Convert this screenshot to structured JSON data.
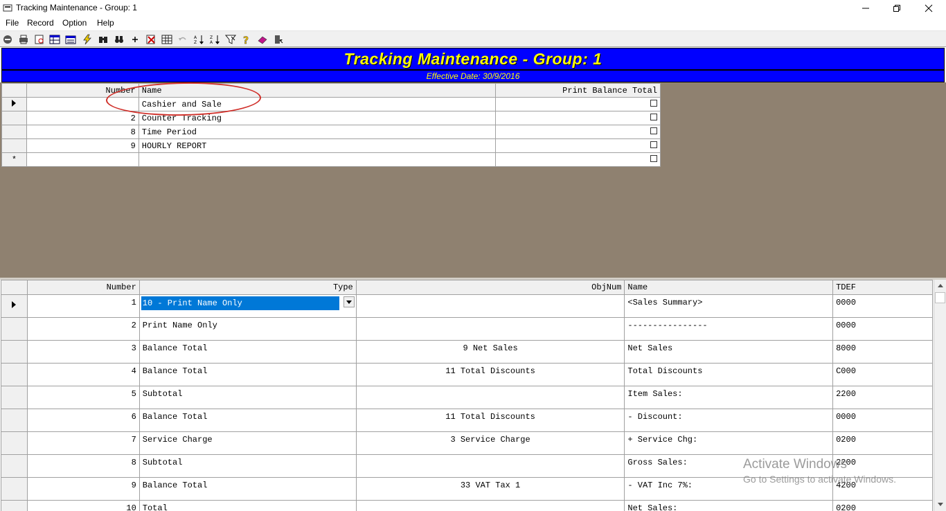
{
  "window": {
    "title": "Tracking Maintenance - Group: 1"
  },
  "menu": [
    "File",
    "Record",
    "Option",
    "Help"
  ],
  "toolbar_icons": [
    "exit-icon",
    "print-icon",
    "print-preview-icon",
    "table-view-icon",
    "form-view-icon",
    "lightning-icon",
    "find-icon",
    "binoculars-icon",
    "add-icon",
    "delete-icon",
    "grid-icon",
    "undo-icon",
    "sort-ascending-icon",
    "sort-descending-icon",
    "filter-icon",
    "help-icon",
    "eraser-icon",
    "door-exit-icon"
  ],
  "banner": {
    "title": "Tracking Maintenance - Group: 1",
    "effective_date": "Effective Date: 30/9/2016"
  },
  "groups_grid": {
    "columns": [
      "Number",
      "Name",
      "Print Balance Total"
    ],
    "rows": [
      {
        "number": "",
        "name": "Cashier and Sale",
        "print_balance_total": false
      },
      {
        "number": "2",
        "name": "Counter Tracking",
        "print_balance_total": false
      },
      {
        "number": "8",
        "name": "Time Period",
        "print_balance_total": false
      },
      {
        "number": "9",
        "name": "HOURLY REPORT",
        "print_balance_total": false
      },
      {
        "number": "",
        "name": "",
        "print_balance_total": false
      }
    ],
    "new_row_marker": "*"
  },
  "detail_grid": {
    "columns": [
      "Number",
      "Type",
      "ObjNum",
      "Name",
      "TDEF"
    ],
    "rows": [
      {
        "number": "1",
        "type": "10 - Print Name Only",
        "objnum": "",
        "name": "<Sales Summary>",
        "tdef": "0000"
      },
      {
        "number": "2",
        "type": "Print Name Only",
        "objnum": "",
        "name": "----------------",
        "tdef": "0000"
      },
      {
        "number": "3",
        "type": "Balance Total",
        "objnum": "9 Net Sales",
        "name": "Net Sales",
        "tdef": "8000"
      },
      {
        "number": "4",
        "type": "Balance Total",
        "objnum": "11 Total Discounts",
        "name": "Total Discounts",
        "tdef": "C000"
      },
      {
        "number": "5",
        "type": "Subtotal",
        "objnum": "",
        "name": "Item Sales:",
        "tdef": "2200"
      },
      {
        "number": "6",
        "type": "Balance Total",
        "objnum": "11 Total Discounts",
        "name": "- Discount:",
        "tdef": "0000"
      },
      {
        "number": "7",
        "type": "Service Charge",
        "objnum": "3 Service Charge",
        "name": "+ Service Chg:",
        "tdef": "0200"
      },
      {
        "number": "8",
        "type": "Subtotal",
        "objnum": "",
        "name": "Gross Sales:",
        "tdef": "2200"
      },
      {
        "number": "9",
        "type": "Balance Total",
        "objnum": "33 VAT Tax 1",
        "name": "- VAT Inc 7%:",
        "tdef": "4200"
      },
      {
        "number": "10",
        "type": "Total",
        "objnum": "",
        "name": "Net Sales:",
        "tdef": "0200"
      }
    ]
  },
  "watermark": {
    "line1": "Activate Windows",
    "line2": "Go to Settings to activate Windows."
  },
  "colors": {
    "banner_bg": "#0000ff",
    "banner_text": "#ffff00",
    "panel_bg": "#8f8170",
    "selection": "#0078d7",
    "annotation": "#d0302a"
  }
}
